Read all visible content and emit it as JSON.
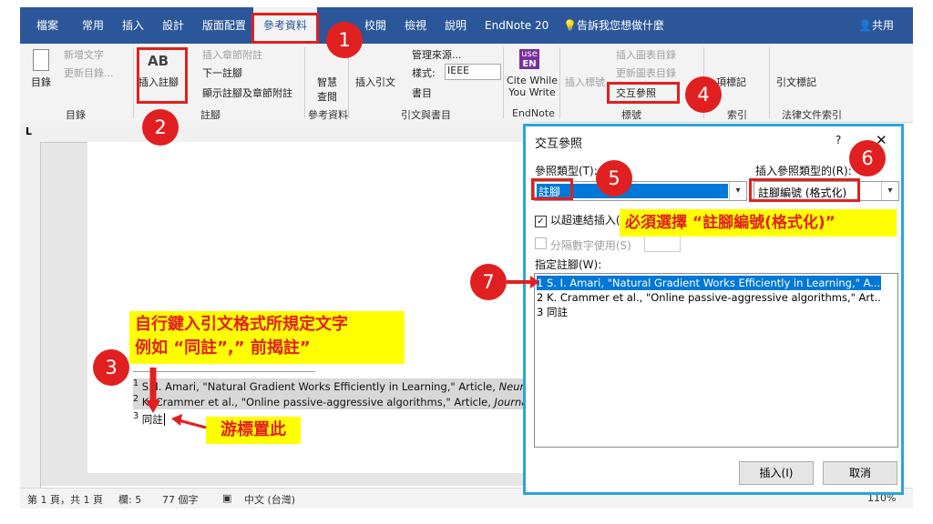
{
  "tabs": {
    "file": "檔案",
    "home": "常用",
    "insert": "插入",
    "design": "設計",
    "layout": "版面配置",
    "references": "參考資料",
    "review": "校閱",
    "view": "檢視",
    "help": "說明",
    "endnote": "EndNote 20",
    "tellme": "告訴我您想做什麼",
    "share": "共用"
  },
  "ribbon": {
    "toc": "目錄",
    "add_text": "新增文字",
    "update_toc": "更新目錄...",
    "insert_footnote": "插入註腳",
    "footnote_ab": "AB",
    "insert_endnote": "插入章節附註",
    "next_footnote": "下一註腳",
    "show_notes": "顯示註腳及章節附註",
    "smart_lookup_1": "智慧",
    "smart_lookup_2": "查閱",
    "insert_citation": "插入引文",
    "manage_sources": "管理來源...",
    "style_label": "樣式:",
    "style_value": "IEEE",
    "bibliography": "書目",
    "endnote_badge": "EN",
    "endnote_use": "use",
    "cite_while_1": "Cite While",
    "cite_while_2": "You Write",
    "insert_caption": "插入標號",
    "insert_table_figures": "插入圖表目錄",
    "update_table": "更新圖表目錄",
    "cross_reference": "交互參照",
    "mark_entry": "項標記",
    "mark_citation": "引文標記",
    "group_toc": "目錄",
    "group_footnotes": "註腳",
    "group_research": "參考資料",
    "group_citations": "引文與書目",
    "group_endnote": "EndNote",
    "group_captions": "標號",
    "group_index": "索引",
    "group_toa": "法律文件索引"
  },
  "ruler_text": "L",
  "document": {
    "footnote_1_num": "1",
    "footnote_1_text": "S. I. Amari, \"Natural Gradient Works Efficiently in Learning,\" Article, ",
    "footnote_1_journal": "Neur",
    "footnote_2_num": "2",
    "footnote_2_text": "K. Crammer et al., \"Online passive-aggressive algorithms,\" Article, ",
    "footnote_2_journal": "Journa",
    "footnote_3_num": "3",
    "footnote_3_text": "同註"
  },
  "status": {
    "page": "第 1 頁，共 1 頁",
    "column": "欄: 5",
    "words": "77 個字",
    "lang": "中文 (台灣)",
    "zoom": "110%"
  },
  "dialog": {
    "title": "交互參照",
    "help": "?",
    "close": "✕",
    "ref_type_label": "參照類型(T):",
    "ref_type_value": "註腳",
    "insert_ref_label": "插入參照類型的(R):",
    "insert_ref_value": "註腳編號 (格式化)",
    "hyperlink_label": "以超連結插入(",
    "separate_label": "分隔數字使用(S)",
    "for_which_label": "指定註腳(W):",
    "items": [
      "1  S. I. Amari, \"Natural Gradient Works Efficiently in Learning,\" A...",
      "2  K. Crammer et al., \"Online passive-aggressive algorithms,\" Art...",
      "3  同註"
    ],
    "insert_btn": "插入(I)",
    "cancel_btn": "取消"
  },
  "annotations": {
    "badges": [
      "1",
      "2",
      "3",
      "4",
      "5",
      "6",
      "7"
    ],
    "callout_must": "必須選擇 “註腳編號(格式化)”",
    "callout_type_1": "自行鍵入引文格式所規定文字",
    "callout_type_2": "例如 “同註”,” 前揭註”",
    "callout_cursor": "游標置此"
  },
  "colors": {
    "accent": "#2b579a",
    "highlight": "#e02020",
    "callout": "#ffff00",
    "dialog_border": "#2aa4dc",
    "selection": "#0078d7"
  }
}
